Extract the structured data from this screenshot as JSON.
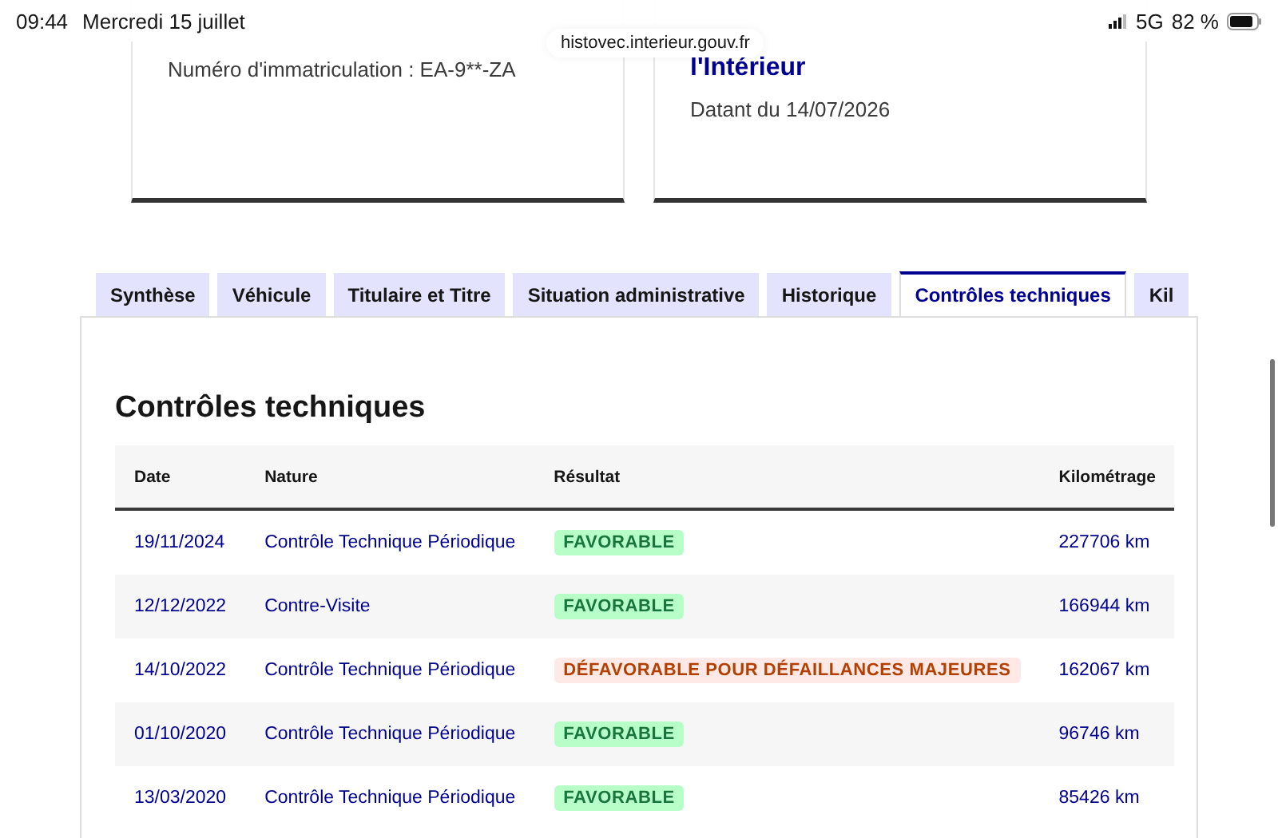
{
  "status_bar": {
    "time": "09:44",
    "date": "Mercredi 15 juillet",
    "network": "5G",
    "battery": "82 %"
  },
  "address_bar": {
    "url": "histovec.interieur.gouv.fr"
  },
  "cards": [
    {
      "lines": [
        {
          "kind": "text",
          "text": "Numéro d'immatriculation : EA-9**-ZA"
        }
      ]
    },
    {
      "lines": [
        {
          "kind": "heading",
          "text": "l'Intérieur"
        },
        {
          "kind": "text",
          "text": "Datant du 14/07/2026"
        }
      ]
    }
  ],
  "tabs": [
    {
      "label": "Synthèse",
      "selected": false
    },
    {
      "label": "Véhicule",
      "selected": false
    },
    {
      "label": "Titulaire et Titre",
      "selected": false
    },
    {
      "label": "Situation administrative",
      "selected": false
    },
    {
      "label": "Historique",
      "selected": false
    },
    {
      "label": "Contrôles techniques",
      "selected": true
    },
    {
      "label": "Kil",
      "selected": false
    }
  ],
  "section": {
    "title": "Contrôles techniques"
  },
  "table": {
    "columns": [
      "Date",
      "Nature",
      "Résultat",
      "Kilométrage"
    ],
    "rows": [
      {
        "date": "19/11/2024",
        "nature": "Contrôle Technique Périodique",
        "result": {
          "label": "FAVORABLE",
          "kind": "success"
        },
        "km": "227706 km"
      },
      {
        "date": "12/12/2022",
        "nature": "Contre-Visite",
        "result": {
          "label": "FAVORABLE",
          "kind": "success"
        },
        "km": "166944 km"
      },
      {
        "date": "14/10/2022",
        "nature": "Contrôle Technique Périodique",
        "result": {
          "label": "DÉFAVORABLE POUR DÉFAILLANCES MAJEURES",
          "kind": "error"
        },
        "km": "162067 km"
      },
      {
        "date": "01/10/2020",
        "nature": "Contrôle Technique Périodique",
        "result": {
          "label": "FAVORABLE",
          "kind": "success"
        },
        "km": "96746 km"
      },
      {
        "date": "13/03/2020",
        "nature": "Contrôle Technique Périodique",
        "result": {
          "label": "FAVORABLE",
          "kind": "success"
        },
        "km": "85426 km"
      }
    ]
  }
}
